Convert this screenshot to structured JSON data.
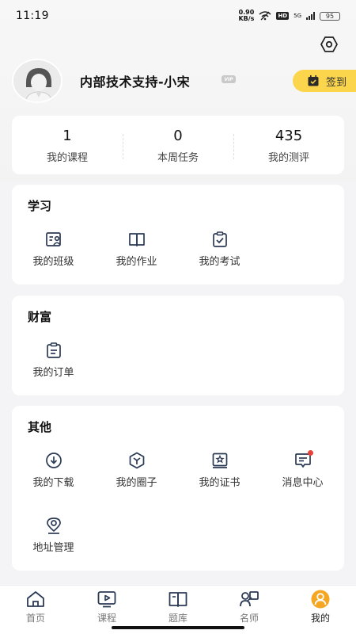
{
  "status_bar": {
    "time": "11:19",
    "net_speed_value": "0.90",
    "net_speed_unit": "KB/s",
    "hd_label": "HD",
    "network": "5G",
    "battery": "95"
  },
  "profile": {
    "username": "内部技术支持-小宋",
    "vip_label": "VIP",
    "checkin_label": "签到"
  },
  "stats": [
    {
      "value": "1",
      "label": "我的课程"
    },
    {
      "value": "0",
      "label": "本周任务"
    },
    {
      "value": "435",
      "label": "我的测评"
    }
  ],
  "sections": {
    "study": {
      "title": "学习",
      "items": [
        {
          "label": "我的班级",
          "icon": "class-icon"
        },
        {
          "label": "我的作业",
          "icon": "homework-book-icon"
        },
        {
          "label": "我的考试",
          "icon": "exam-clipboard-icon"
        }
      ]
    },
    "wealth": {
      "title": "财富",
      "items": [
        {
          "label": "我的订单",
          "icon": "order-clipboard-icon"
        }
      ]
    },
    "other": {
      "title": "其他",
      "items": [
        {
          "label": "我的下载",
          "icon": "download-icon"
        },
        {
          "label": "我的圈子",
          "icon": "circle-icon"
        },
        {
          "label": "我的证书",
          "icon": "certificate-icon"
        },
        {
          "label": "消息中心",
          "icon": "message-icon",
          "badge_dot": true
        },
        {
          "label": "地址管理",
          "icon": "location-pin-icon"
        }
      ]
    }
  },
  "tabbar": {
    "items": [
      {
        "label": "首页",
        "icon": "home-icon"
      },
      {
        "label": "课程",
        "icon": "course-play-icon"
      },
      {
        "label": "题库",
        "icon": "question-bank-book-icon"
      },
      {
        "label": "名师",
        "icon": "teacher-icon"
      },
      {
        "label": "我的",
        "icon": "profile-icon",
        "active": true
      }
    ]
  },
  "colors": {
    "accent_yellow": "#fbd64c",
    "active_orange": "#f5a623",
    "icon_stroke": "#2b3a55",
    "badge_red": "#e8423a"
  }
}
